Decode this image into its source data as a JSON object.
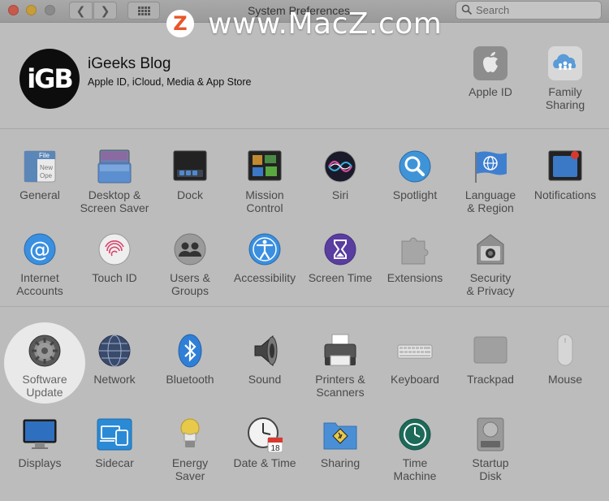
{
  "window": {
    "title": "System Preferences",
    "search_placeholder": "Search"
  },
  "watermark": {
    "logo": "Z",
    "text": "www.MacZ.com"
  },
  "profile": {
    "avatar_text": "iGB",
    "name": "iGeeks Blog",
    "subtitle": "Apple ID, iCloud, Media & App Store"
  },
  "account_items": [
    {
      "label": "Apple ID",
      "icon": "apple-id-icon"
    },
    {
      "label": "Family\nSharing",
      "icon": "family-sharing-icon"
    }
  ],
  "row1": [
    {
      "label": "General",
      "icon": "general-icon"
    },
    {
      "label": "Desktop &\nScreen Saver",
      "icon": "desktop-screen-saver-icon"
    },
    {
      "label": "Dock",
      "icon": "dock-icon"
    },
    {
      "label": "Mission\nControl",
      "icon": "mission-control-icon"
    },
    {
      "label": "Siri",
      "icon": "siri-icon"
    },
    {
      "label": "Spotlight",
      "icon": "spotlight-icon"
    },
    {
      "label": "Language\n& Region",
      "icon": "language-region-icon"
    },
    {
      "label": "Notifications",
      "icon": "notifications-icon"
    }
  ],
  "row2": [
    {
      "label": "Internet\nAccounts",
      "icon": "internet-accounts-icon"
    },
    {
      "label": "Touch ID",
      "icon": "touch-id-icon"
    },
    {
      "label": "Users &\nGroups",
      "icon": "users-groups-icon"
    },
    {
      "label": "Accessibility",
      "icon": "accessibility-icon"
    },
    {
      "label": "Screen Time",
      "icon": "screen-time-icon"
    },
    {
      "label": "Extensions",
      "icon": "extensions-icon"
    },
    {
      "label": "Security\n& Privacy",
      "icon": "security-privacy-icon"
    }
  ],
  "row3": [
    {
      "label": "Software\nUpdate",
      "icon": "software-update-icon",
      "highlighted": true
    },
    {
      "label": "Network",
      "icon": "network-icon"
    },
    {
      "label": "Bluetooth",
      "icon": "bluetooth-icon"
    },
    {
      "label": "Sound",
      "icon": "sound-icon"
    },
    {
      "label": "Printers &\nScanners",
      "icon": "printers-scanners-icon"
    },
    {
      "label": "Keyboard",
      "icon": "keyboard-icon"
    },
    {
      "label": "Trackpad",
      "icon": "trackpad-icon"
    },
    {
      "label": "Mouse",
      "icon": "mouse-icon"
    }
  ],
  "row4": [
    {
      "label": "Displays",
      "icon": "displays-icon"
    },
    {
      "label": "Sidecar",
      "icon": "sidecar-icon"
    },
    {
      "label": "Energy\nSaver",
      "icon": "energy-saver-icon"
    },
    {
      "label": "Date & Time",
      "icon": "date-time-icon",
      "calendar_day": "18"
    },
    {
      "label": "Sharing",
      "icon": "sharing-icon"
    },
    {
      "label": "Time\nMachine",
      "icon": "time-machine-icon"
    },
    {
      "label": "Startup\nDisk",
      "icon": "startup-disk-icon"
    }
  ],
  "colors": {
    "background": "#bcbcbc",
    "highlight": "#e9e9e9",
    "label_text": "#4a4a4a",
    "watermark_accent": "#e8562a"
  }
}
